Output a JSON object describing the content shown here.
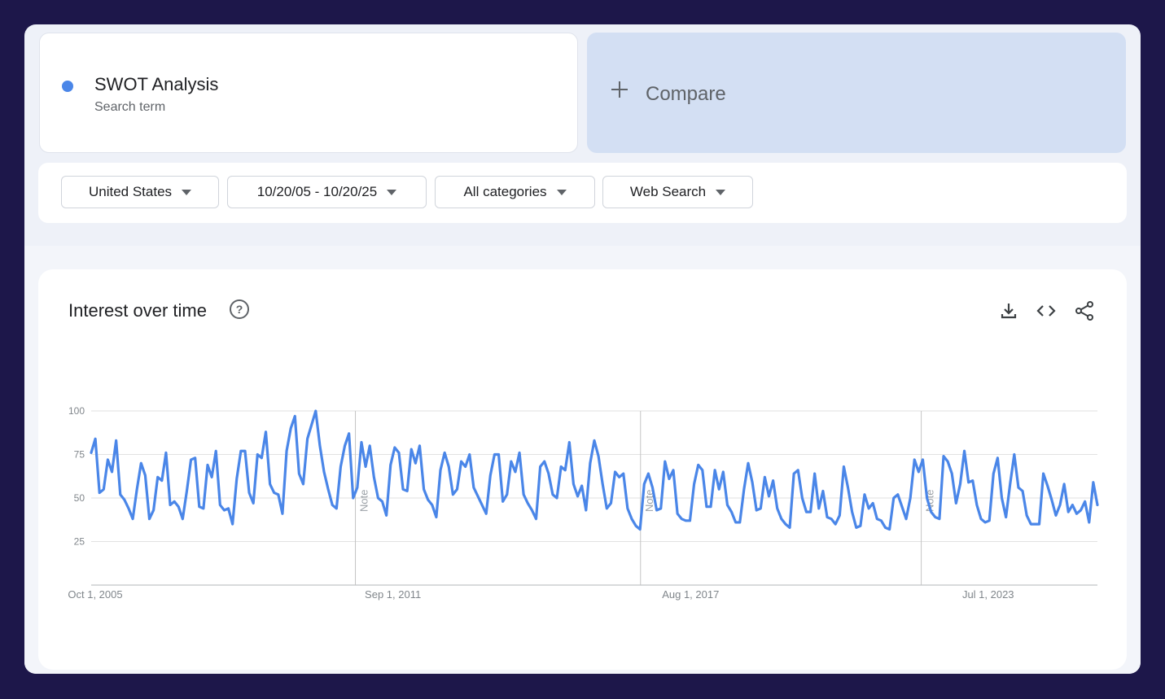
{
  "search_term": {
    "name": "SWOT Analysis",
    "type": "Search term",
    "color": "#4a86e8"
  },
  "compare": {
    "label": "Compare"
  },
  "filters": [
    {
      "label": "United States"
    },
    {
      "label": "10/20/05 - 10/20/25"
    },
    {
      "label": "All categories"
    },
    {
      "label": "Web Search"
    }
  ],
  "chart": {
    "title": "Interest over time",
    "tools": [
      "download-icon",
      "embed-code-icon",
      "share-icon"
    ]
  },
  "chart_data": {
    "type": "line",
    "xlabel": "",
    "ylabel": "",
    "ylim": [
      0,
      100
    ],
    "y_ticks": [
      25,
      50,
      75,
      100
    ],
    "x_ticks": [
      {
        "label": "Oct 1, 2005",
        "date": "2005-10-01"
      },
      {
        "label": "Sep 1, 2011",
        "date": "2011-09-01"
      },
      {
        "label": "Aug 1, 2017",
        "date": "2017-08-01"
      },
      {
        "label": "Jul 1, 2023",
        "date": "2023-07-01"
      }
    ],
    "notes": [
      {
        "label": "Note",
        "date": "2011-01-01"
      },
      {
        "label": "Note",
        "date": "2016-09-01"
      },
      {
        "label": "Note",
        "date": "2022-04-01"
      }
    ],
    "x_start": "2005-10-01",
    "x_end": "2025-10-01",
    "line_color": "#4a86e8",
    "grid": true,
    "series": [
      {
        "values": [
          76,
          84,
          53,
          55,
          72,
          65,
          83,
          52,
          49,
          44,
          38,
          55,
          70,
          63,
          38,
          43,
          62,
          60,
          76,
          46,
          48,
          45,
          38,
          54,
          72,
          73,
          45,
          44,
          69,
          62,
          77,
          46,
          43,
          44,
          35,
          61,
          77,
          77,
          53,
          47,
          75,
          73,
          88,
          58,
          53,
          52,
          41,
          77,
          90,
          97,
          64,
          58,
          84,
          92,
          100,
          80,
          65,
          55,
          46,
          44,
          68,
          80,
          87,
          50,
          56,
          82,
          68,
          80,
          62,
          50,
          48,
          40,
          69,
          79,
          76,
          55,
          54,
          78,
          70,
          80,
          55,
          49,
          46,
          39,
          66,
          76,
          68,
          52,
          55,
          71,
          68,
          75,
          56,
          51,
          46,
          41,
          63,
          75,
          75,
          48,
          52,
          71,
          65,
          76,
          52,
          47,
          43,
          38,
          68,
          71,
          64,
          52,
          50,
          68,
          66,
          82,
          58,
          51,
          57,
          43,
          70,
          83,
          74,
          58,
          44,
          47,
          65,
          62,
          64,
          44,
          38,
          34,
          32,
          58,
          64,
          56,
          43,
          44,
          71,
          61,
          66,
          41,
          38,
          37,
          37,
          58,
          69,
          66,
          45,
          45,
          66,
          55,
          65,
          46,
          42,
          36,
          36,
          55,
          70,
          59,
          43,
          44,
          62,
          51,
          60,
          44,
          38,
          35,
          33,
          64,
          66,
          50,
          42,
          42,
          64,
          44,
          54,
          39,
          38,
          35,
          40,
          68,
          56,
          42,
          33,
          34,
          52,
          44,
          47,
          38,
          37,
          33,
          32,
          50,
          52,
          45,
          38,
          50,
          72,
          65,
          72,
          50,
          42,
          39,
          38,
          74,
          71,
          64,
          47,
          58,
          77,
          59,
          60,
          46,
          38,
          36,
          37,
          64,
          73,
          50,
          39,
          58,
          75,
          56,
          54,
          40,
          35,
          35,
          35,
          64,
          57,
          49,
          40,
          46,
          58,
          42,
          46,
          41,
          43,
          48,
          36,
          59,
          46
        ]
      }
    ]
  }
}
